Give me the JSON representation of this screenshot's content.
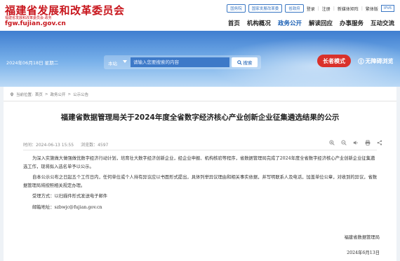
{
  "header": {
    "title": "福建省发展和改革委员会",
    "subtitle": "福建省发展和改革委员会·政务",
    "url": "fgw.fujian.gov.cn",
    "pills": [
      "国务院",
      "国家发展改革委",
      "省政府"
    ],
    "links": [
      "登录",
      "注册",
      "新媒体矩阵",
      "繁体版"
    ],
    "ipv6": "IPV6"
  },
  "nav": [
    "首页",
    "机构概况",
    "政务公开",
    "解读回应",
    "办事服务",
    "互动交流"
  ],
  "nav_active": "政务公开",
  "banner": {
    "date": "2024年06月18日 星期二",
    "search_scope": "本站",
    "search_placeholder": "请输入您要搜索的内容",
    "search_button": "搜索",
    "elder_mode": "长者模式",
    "accessible": "无障碍浏览"
  },
  "breadcrumb": [
    "当前位置:",
    "首页",
    "政务公开",
    "公示公告"
  ],
  "article": {
    "title": "福建省数据管理局关于2024年度全省数字经济核心产业创新企业征集遴选结果的公示",
    "time": "时间：2024-06-13 15:55",
    "views": "浏览数：4597",
    "paragraphs": [
      "为深入实施做大做强做优数字经济行动计划，培育壮大数字经济创新企业，经企业申报、机构核验等程序，省数据管理局完成了2024年度全省数字经济核心产业创新企业征集遴选工作，现将拟入选名单予以公示。",
      "自本公示公布之日起五个工作日内，任何单位或个人持有异议应以书面形式提出，具体列举异议理由和相关事实依据，并写明联系人及电话，加盖单位公章，对收到的异议，省数据管理局将按照相关规定办理。",
      "受理方式：以扫描件形式发送电子邮件",
      "邮箱地址：szbwjc@fujian.gov.cn"
    ],
    "signature": "福建省数据管理局",
    "sign_date": "2024年6月13日"
  }
}
